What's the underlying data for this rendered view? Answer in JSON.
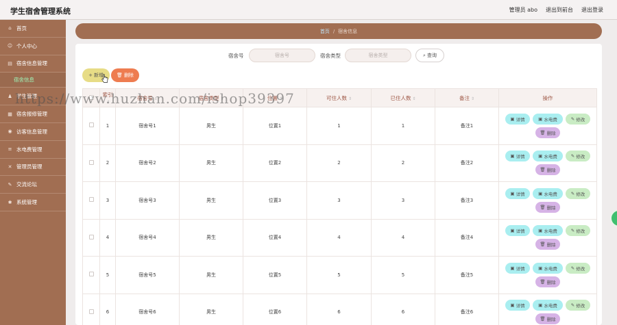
{
  "app": {
    "title": "学生宿舍管理系统",
    "user_label": "管理员 abo",
    "exit_front": "退出到前台",
    "logout": "退出登录"
  },
  "sidebar": {
    "items": [
      {
        "label": "首页",
        "icon": "home-icon"
      },
      {
        "label": "个人中心",
        "icon": "user-icon"
      },
      {
        "label": "宿舍信息管理",
        "icon": "building-icon"
      },
      {
        "label": "学生管理",
        "icon": "student-icon"
      },
      {
        "label": "宿舍报修管理",
        "icon": "wrench-icon"
      },
      {
        "label": "访客信息管理",
        "icon": "visitor-icon"
      },
      {
        "label": "水电费管理",
        "icon": "bolt-icon"
      },
      {
        "label": "管理员管理",
        "icon": "admin-icon"
      },
      {
        "label": "交流论坛",
        "icon": "forum-icon"
      },
      {
        "label": "系统管理",
        "icon": "gear-icon"
      }
    ],
    "sub_active": "宿舍信息"
  },
  "breadcrumb": {
    "home": "首页",
    "current": "宿舍信息"
  },
  "search": {
    "label_no": "宿舍号",
    "placeholder_no": "宿舍号",
    "label_type": "宿舍类型",
    "placeholder_type": "宿舍类型",
    "query_label": "查询"
  },
  "actions": {
    "add_label": "新增",
    "delete_label": "删除"
  },
  "table": {
    "headers": [
      "索引",
      "宿舍号",
      "宿舍类型",
      "位置",
      "可住人数",
      "已住人数",
      "备注",
      "操作"
    ],
    "rows": [
      {
        "index": "1",
        "no": "宿舍号1",
        "type": "男生",
        "loc": "位置1",
        "cap": "1",
        "used": "1",
        "note": "备注1"
      },
      {
        "index": "2",
        "no": "宿舍号2",
        "type": "男生",
        "loc": "位置2",
        "cap": "2",
        "used": "2",
        "note": "备注2"
      },
      {
        "index": "3",
        "no": "宿舍号3",
        "type": "男生",
        "loc": "位置3",
        "cap": "3",
        "used": "3",
        "note": "备注3"
      },
      {
        "index": "4",
        "no": "宿舍号4",
        "type": "男生",
        "loc": "位置4",
        "cap": "4",
        "used": "4",
        "note": "备注4"
      },
      {
        "index": "5",
        "no": "宿舍号5",
        "type": "男生",
        "loc": "位置5",
        "cap": "5",
        "used": "5",
        "note": "备注5"
      },
      {
        "index": "6",
        "no": "宿舍号6",
        "type": "男生",
        "loc": "位置6",
        "cap": "6",
        "used": "6",
        "note": "备注6"
      }
    ],
    "op_detail": "详情",
    "op_water": "水电费",
    "op_edit": "修改",
    "op_delete": "删除"
  },
  "watermark": "https://www.huzhan.com/ishop39397",
  "colors": {
    "sidebar": "#a16e52",
    "accent_green": "#9ff5b8",
    "delete_orange": "#ee7c50",
    "add_yellow": "#e7dc86"
  }
}
